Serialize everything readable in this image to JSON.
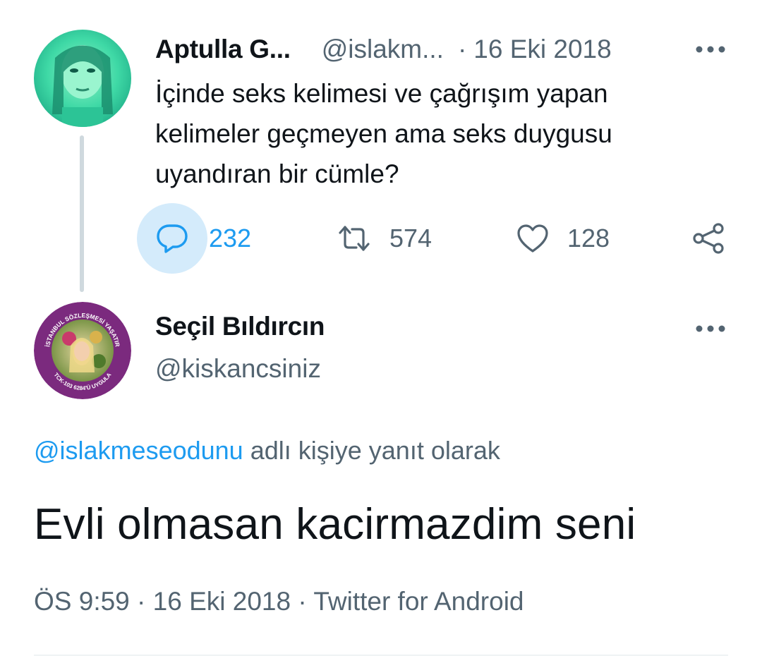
{
  "parent_tweet": {
    "display_name": "Aptulla G...",
    "handle": "@islakm...",
    "separator": "·",
    "date": "16 Eki 2018",
    "text": "İçinde seks kelimesi ve çağrışım yapan\nkelimeler geçmeyen ama seks duygusu\nuyandıran bir cümle?",
    "reply_count": "232",
    "retweet_count": "574",
    "like_count": "128"
  },
  "reply_tweet": {
    "display_name": "Seçil Bıldırcın",
    "handle": "@kiskancsiniz",
    "avatar_ring_text_top": "İSTANBUL SÖZLEŞMESİ YAŞATIR",
    "avatar_ring_text_bottom": "TCK-103  6284'Ü UYGULA",
    "replying_mention": "@islakmeseodunu",
    "replying_suffix": "adlı kişiye yanıt olarak",
    "text": "Evli olmasan kacirmazdim seni",
    "time": "ÖS 9:59",
    "date": "16 Eki 2018",
    "source": "Twitter for Android"
  },
  "colors": {
    "accent": "#1d9bf0",
    "text_primary": "#0f1419",
    "text_secondary": "#536471",
    "reply_highlight": "#d4ebfb",
    "thread_line": "#cfd9de",
    "avatar_ring": "#7b2a7e"
  },
  "icons": {
    "more": "more-horizontal-icon",
    "reply": "reply-bubble-icon",
    "retweet": "retweet-icon",
    "like": "heart-icon",
    "share": "share-icon"
  }
}
